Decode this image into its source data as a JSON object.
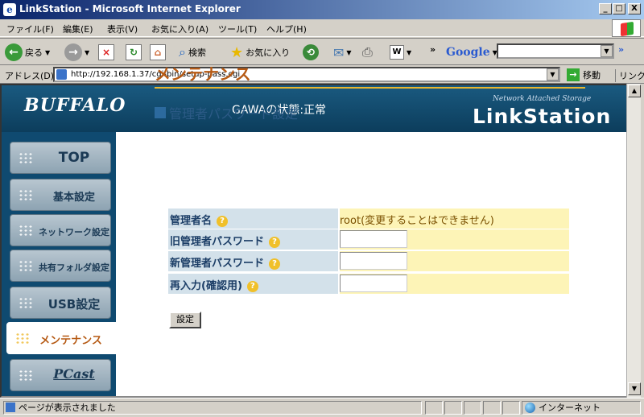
{
  "window": {
    "title": "LinkStation - Microsoft Internet Explorer",
    "minimize": "_",
    "maximize": "□",
    "close": "X"
  },
  "menu": [
    "ファイル(F)",
    "編集(E)",
    "表示(V)",
    "お気に入り(A)",
    "ツール(T)",
    "ヘルプ(H)"
  ],
  "toolbar": {
    "back_label": "戻る",
    "search_label": "検索",
    "favorites_label": "お気に入り",
    "chevron": "»",
    "google_label": "Google",
    "search_value": "",
    "chevron2": "»"
  },
  "address": {
    "label": "アドレス(D)",
    "url": "http://192.168.1.37/cgi-bin/setup-pass.cgi",
    "go_label": "移動",
    "links_label": "リンク"
  },
  "banner": {
    "logo": "BUFFALO",
    "device_status": "GAWAの状態:正常",
    "nas_caption": "Network Attached Storage",
    "product": "LinkStation"
  },
  "nav": [
    {
      "label": "TOP",
      "active": false
    },
    {
      "label": "基本設定",
      "active": false
    },
    {
      "label": "ネットワーク設定",
      "active": false
    },
    {
      "label": "共有フォルダ設定",
      "active": false
    },
    {
      "label": "USB設定",
      "active": false
    },
    {
      "label": "メンテナンス",
      "active": true
    },
    {
      "label": "PCast",
      "active": false
    }
  ],
  "content": {
    "heading": "メンテナンス",
    "section_title": "管理者パスワード設定",
    "help_glyph": "?",
    "fields": [
      {
        "label": "管理者名",
        "value": "root(変更することはできません)"
      },
      {
        "label": "旧管理者パスワード",
        "value": ""
      },
      {
        "label": "新管理者パスワード",
        "value": ""
      },
      {
        "label": "再入力(確認用)",
        "value": ""
      }
    ],
    "submit_label": "設定"
  },
  "status": {
    "text": "ページが表示されました",
    "zone": "インターネット"
  }
}
